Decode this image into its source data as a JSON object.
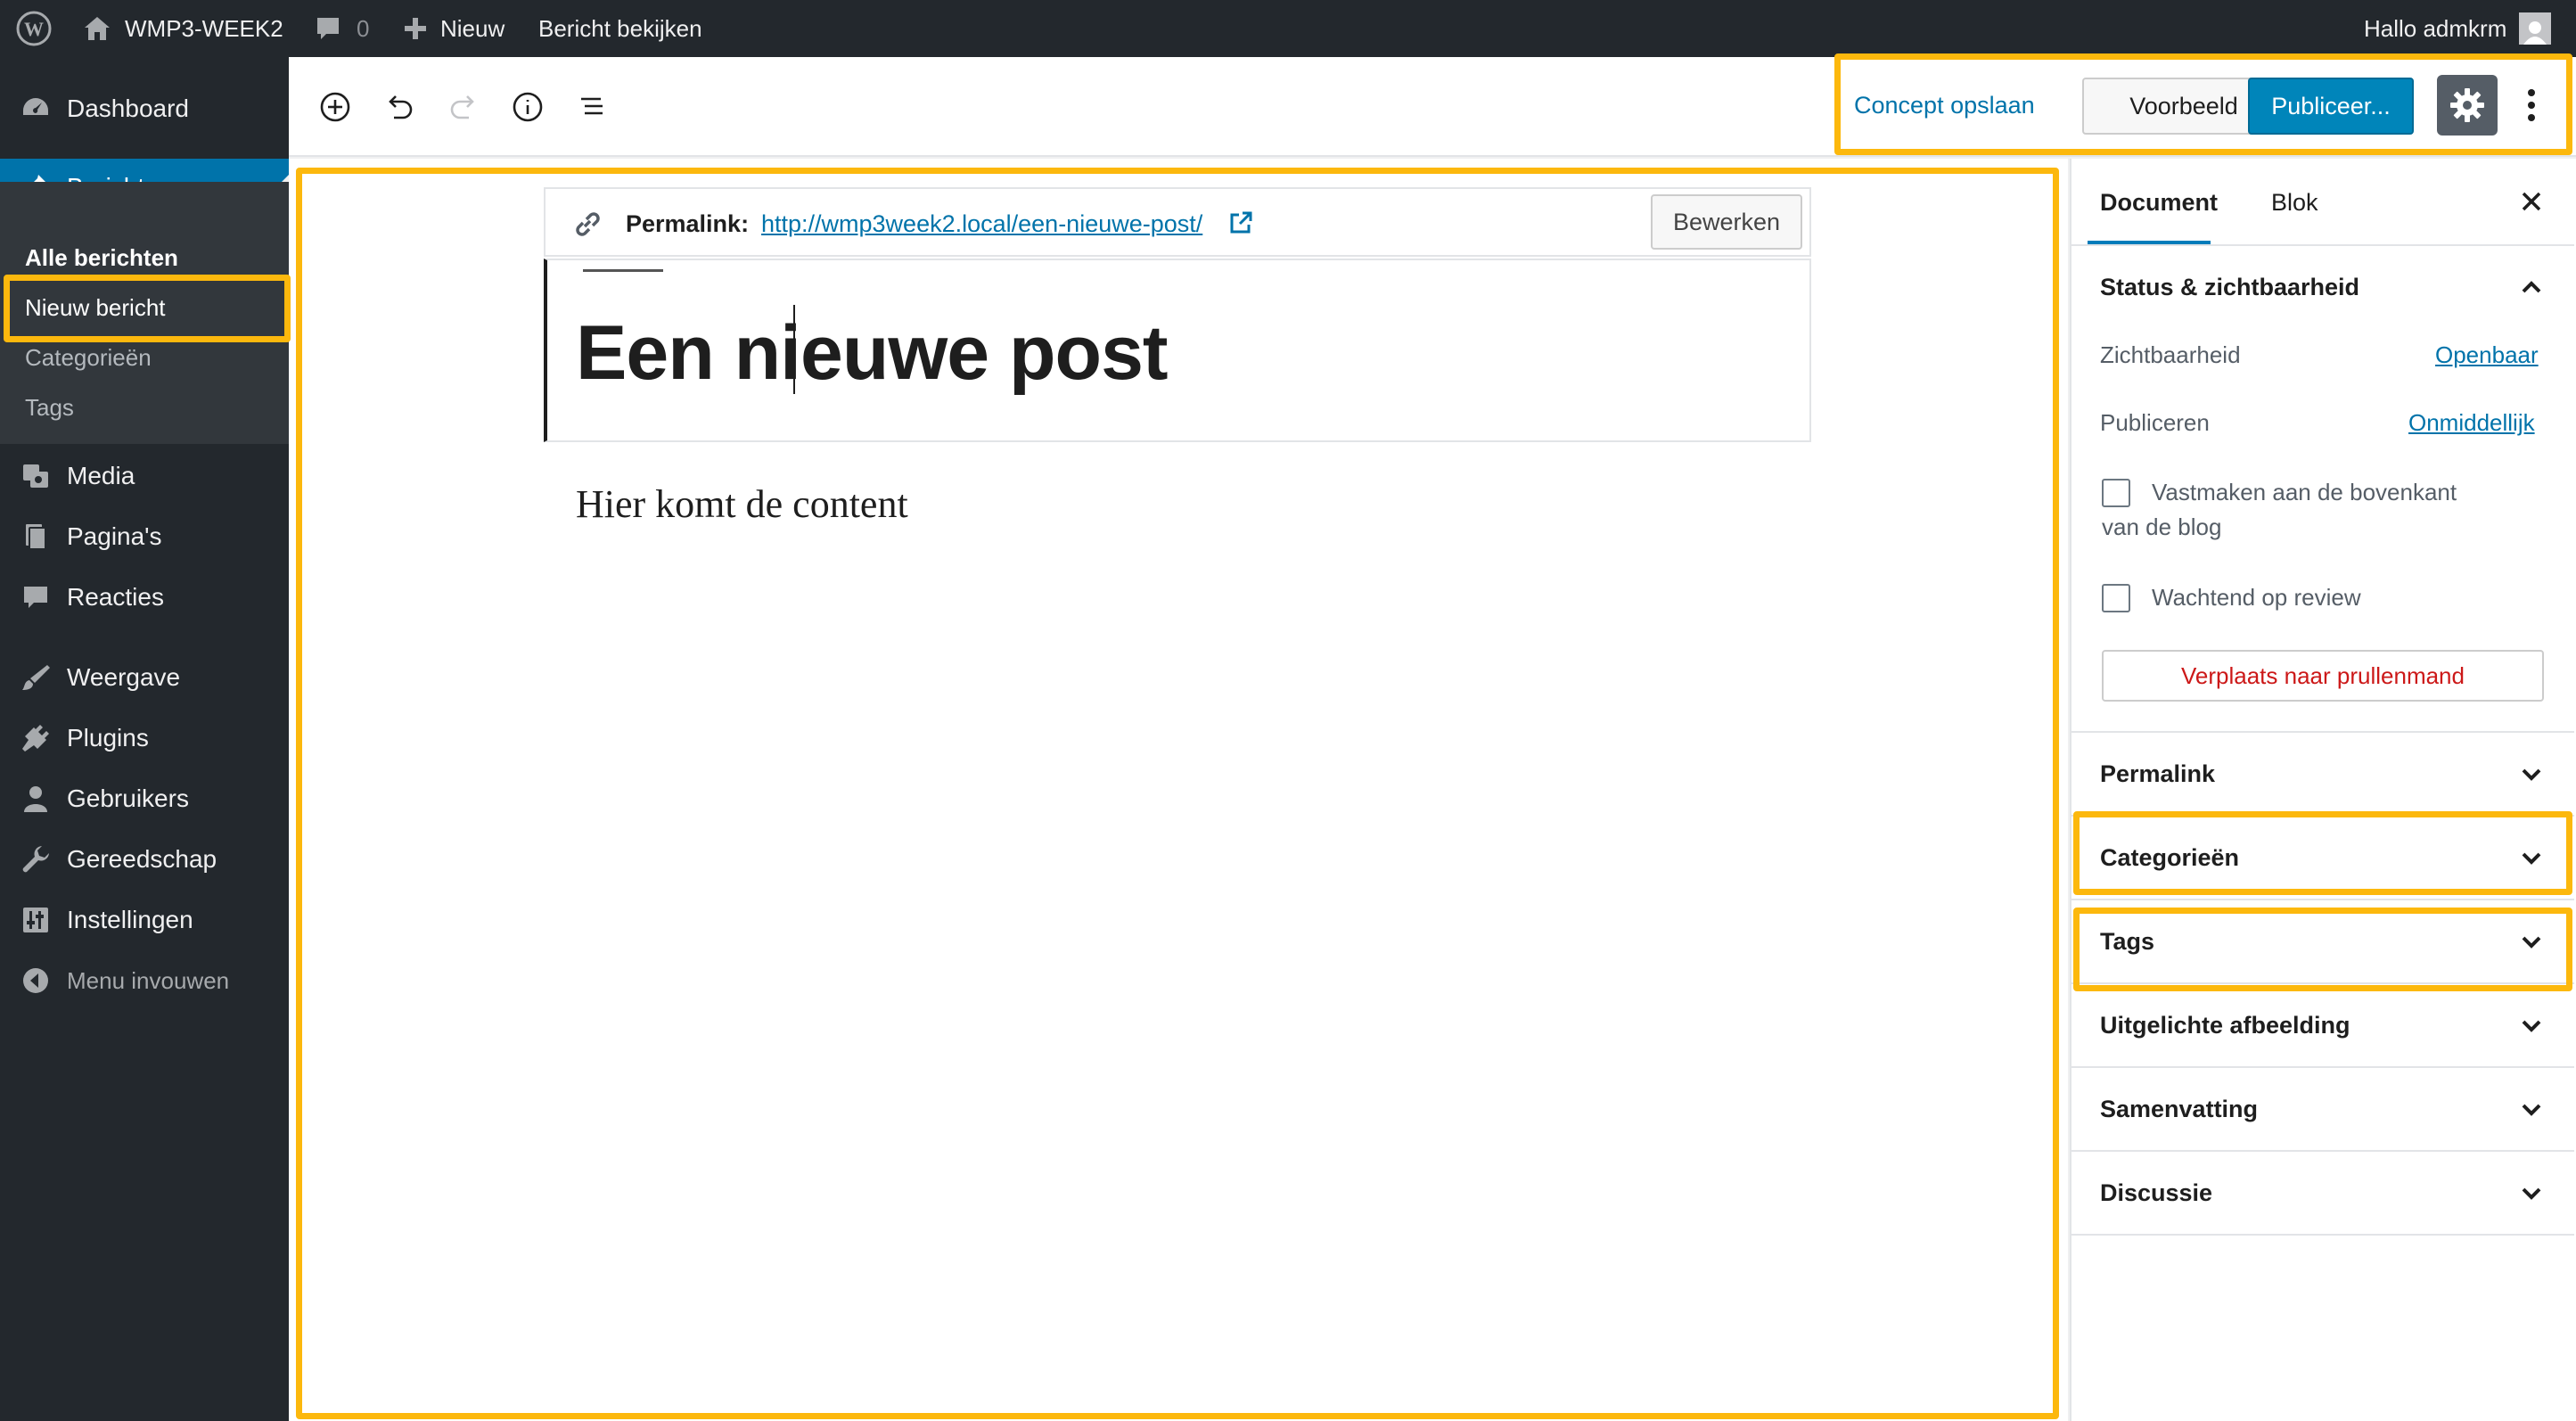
{
  "adminbar": {
    "site_name": "WMP3-WEEK2",
    "comments_count": "0",
    "new_label": "Nieuw",
    "view_post": "Bericht bekijken",
    "greeting": "Hallo admkrm"
  },
  "sidebar": {
    "dashboard": "Dashboard",
    "posts": "Berichten",
    "sub": [
      "Alle berichten",
      "Nieuw bericht",
      "Categorieën",
      "Tags"
    ],
    "media": "Media",
    "pages": "Pagina's",
    "comments": "Reacties",
    "appearance": "Weergave",
    "plugins": "Plugins",
    "users": "Gebruikers",
    "tools": "Gereedschap",
    "settings": "Instellingen",
    "collapse": "Menu invouwen"
  },
  "toolbar": {
    "save_draft": "Concept opslaan",
    "preview": "Voorbeeld",
    "publish": "Publiceer..."
  },
  "editor": {
    "permalink_label": "Permalink:",
    "permalink_url": "http://wmp3week2.local/een-nieuwe-post/",
    "edit_button": "Bewerken",
    "title": "Een nieuwe post",
    "content": "Hier komt de content"
  },
  "panel": {
    "tab_document": "Document",
    "tab_block": "Blok",
    "status_title": "Status & zichtbaarheid",
    "visibility_label": "Zichtbaarheid",
    "visibility_value": "Openbaar",
    "publish_label": "Publiceren",
    "publish_value": "Onmiddellijk",
    "sticky_label": "Vastmaken aan de bovenkant van de blog",
    "pending_label": "Wachtend op review",
    "trash_button": "Verplaats naar prullenmand",
    "sections": [
      "Permalink",
      "Categorieën",
      "Tags",
      "Uitgelichte afbeelding",
      "Samenvatting",
      "Discussie"
    ]
  },
  "colors": {
    "adminbar_bg": "#23282d",
    "accent_blue": "#0073aa",
    "highlight": "#fcb80d",
    "trash_red": "#cc1818"
  }
}
